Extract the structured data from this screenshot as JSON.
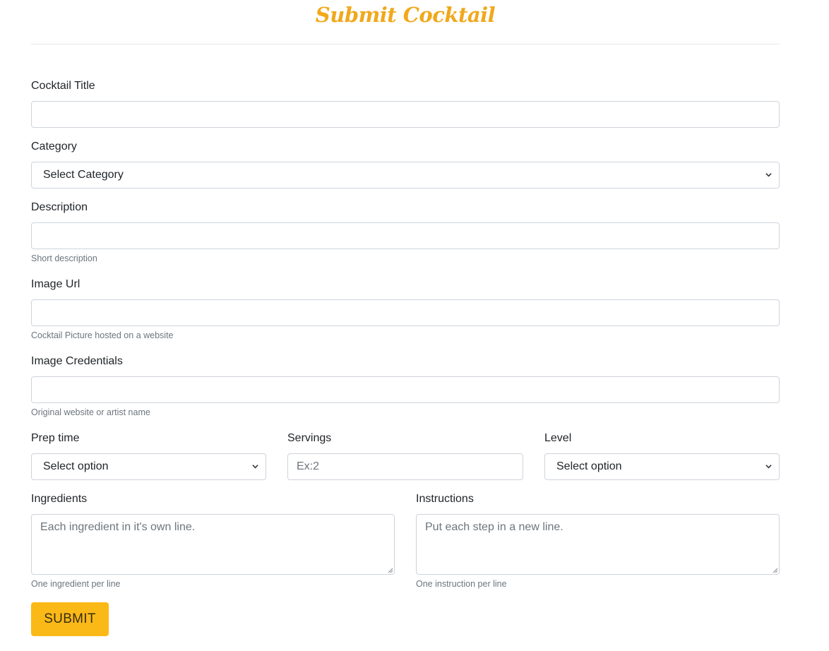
{
  "header": {
    "title": "Submit Cocktail"
  },
  "form": {
    "title": {
      "label": "Cocktail Title",
      "value": ""
    },
    "category": {
      "label": "Category",
      "selected": "Select Category"
    },
    "description": {
      "label": "Description",
      "value": "",
      "help": "Short description"
    },
    "image_url": {
      "label": "Image Url",
      "value": "",
      "help": "Cocktail Picture hosted on a website"
    },
    "image_credentials": {
      "label": "Image Credentials",
      "value": "",
      "help": "Original website or artist name"
    },
    "prep_time": {
      "label": "Prep time",
      "selected": "Select option"
    },
    "servings": {
      "label": "Servings",
      "placeholder": "Ex:2"
    },
    "level": {
      "label": "Level",
      "selected": "Select option"
    },
    "ingredients": {
      "label": "Ingredients",
      "placeholder": "Each ingredient in it's own line.",
      "help": "One ingredient per line"
    },
    "instructions": {
      "label": "Instructions",
      "placeholder": "Put each step in a new line.",
      "help": "One instruction per line"
    },
    "submit_label": "SUBMIT"
  },
  "colors": {
    "title": "#f0a81c",
    "button": "#fbb918",
    "border": "#ced4da",
    "help_text": "#6c757d"
  },
  "icons": {
    "select_arrow": "chevron-down-icon",
    "textarea_resize": "resize-grip-icon"
  }
}
